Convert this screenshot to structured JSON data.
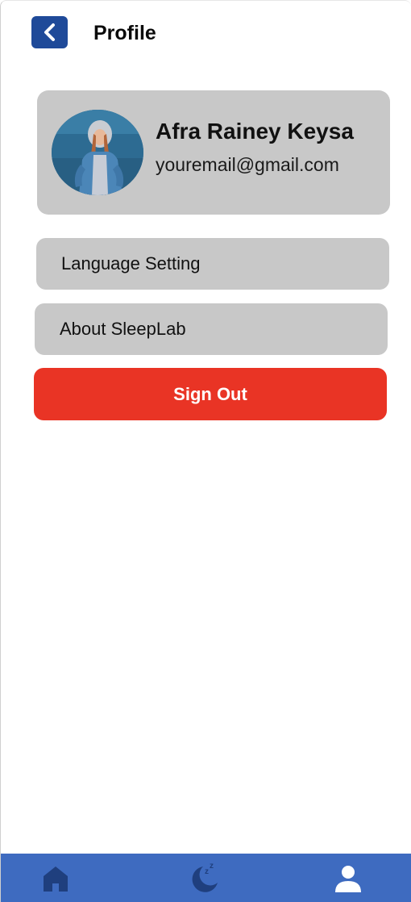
{
  "header": {
    "title": "Profile",
    "back_icon": "chevron-left-icon"
  },
  "profile": {
    "name": "Afra Rainey Keysa",
    "email": "youremail@gmail.com",
    "avatar_icon": "user-photo"
  },
  "menu": {
    "language_label": "Language Setting",
    "about_label": "About SleepLab"
  },
  "signout": {
    "label": "Sign Out"
  },
  "nav": {
    "items": [
      {
        "icon": "home-icon"
      },
      {
        "icon": "sleep-moon-icon"
      },
      {
        "icon": "profile-icon",
        "active": true
      }
    ]
  },
  "colors": {
    "primary": "#1f4a99",
    "nav_bg": "#3e6bc0",
    "card_bg": "#c8c8c8",
    "danger": "#e93425",
    "nav_icon": "#1f3f7e",
    "nav_icon_active": "#ffffff"
  }
}
